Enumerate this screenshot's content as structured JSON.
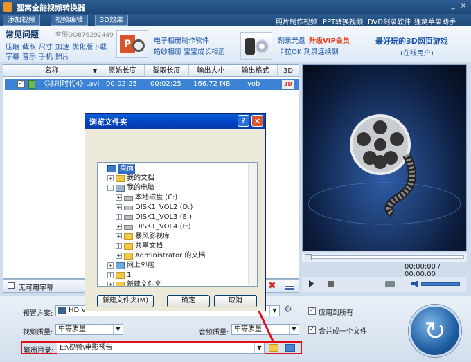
{
  "app": {
    "title": "狸窝全能视频转换器",
    "min": "_",
    "close": "×"
  },
  "menu": {
    "tabs": [
      "添加视频",
      "视频编辑",
      "3D效果"
    ],
    "links": [
      "照片制作视频",
      "PPT转换视频",
      "DVD刻录软件",
      "狸窝苹果助手"
    ]
  },
  "promo": {
    "faq_title": "常见问题",
    "qq": "客服QQ876292449",
    "faq_links": [
      "压缩",
      "截取",
      "尺寸",
      "加速",
      "优化版下载",
      "字幕",
      "音乐",
      "手机",
      "照片"
    ],
    "ad1_line1": "电子相册制作软件",
    "ad1_line2": "婚纱相册 宝宝成长相册",
    "ad2_line1": "刻录光盘",
    "ad2_vip": "升级VIP会员",
    "ad2_line2": "卡拉OK 刻录连续剧",
    "ad3_line1": "最好玩的3D网页游戏",
    "ad3_line2": "(在线用户)"
  },
  "table": {
    "headers": [
      "名称",
      "原始长度",
      "截取长度",
      "输出大小",
      "输出格式",
      "3D"
    ],
    "rows": [
      {
        "name": "《冰川时代4》.avi",
        "orig": "00:02:25",
        "cut": "00:02:25",
        "size": "166.72 MB",
        "format": "vob",
        "d3": "3D"
      }
    ]
  },
  "player": {
    "time": "00:00:00 / 00:00:00"
  },
  "subtitle": {
    "label": "无可用字幕"
  },
  "settings": {
    "preset_label": "预置方案:",
    "preset_value": "HD V",
    "apply_all": "应用到所有",
    "video_q_label": "视频质量:",
    "video_q": "中等质量",
    "audio_q_label": "音频质量:",
    "audio_q": "中等质量",
    "merge": "合并成一个文件",
    "out_label": "输出目录:",
    "out_path": "E:\\视频\\电影预告"
  },
  "dialog": {
    "title": "浏览文件夹",
    "help": "?",
    "close": "×",
    "tree": [
      {
        "label": "桌面",
        "level": 0,
        "icon": "desktop",
        "exp": ""
      },
      {
        "label": "我的文档",
        "level": 1,
        "icon": "folder",
        "exp": "+"
      },
      {
        "label": "我的电脑",
        "level": 1,
        "icon": "computer",
        "exp": "-"
      },
      {
        "label": "本地磁盘 (C:)",
        "level": 2,
        "icon": "drive",
        "exp": "+"
      },
      {
        "label": "DISK1_VOL2 (D:)",
        "level": 2,
        "icon": "drive",
        "exp": "+"
      },
      {
        "label": "DISK1_VOL3 (E:)",
        "level": 2,
        "icon": "drive",
        "exp": "+"
      },
      {
        "label": "DISK1_VOL4 (F:)",
        "level": 2,
        "icon": "drive",
        "exp": "+"
      },
      {
        "label": "暴风影视库",
        "level": 2,
        "icon": "folder",
        "exp": "+"
      },
      {
        "label": "共享文档",
        "level": 2,
        "icon": "folder",
        "exp": "+"
      },
      {
        "label": "Administrator 的文档",
        "level": 2,
        "icon": "folder",
        "exp": "+"
      },
      {
        "label": "网上邻居",
        "level": 1,
        "icon": "network",
        "exp": "+"
      },
      {
        "label": "1",
        "level": 1,
        "icon": "folder",
        "exp": "+"
      },
      {
        "label": "新建文件夹",
        "level": 1,
        "icon": "folder",
        "exp": "+"
      }
    ],
    "new_folder": "新建文件夹(M)",
    "ok": "确定",
    "cancel": "取消"
  }
}
